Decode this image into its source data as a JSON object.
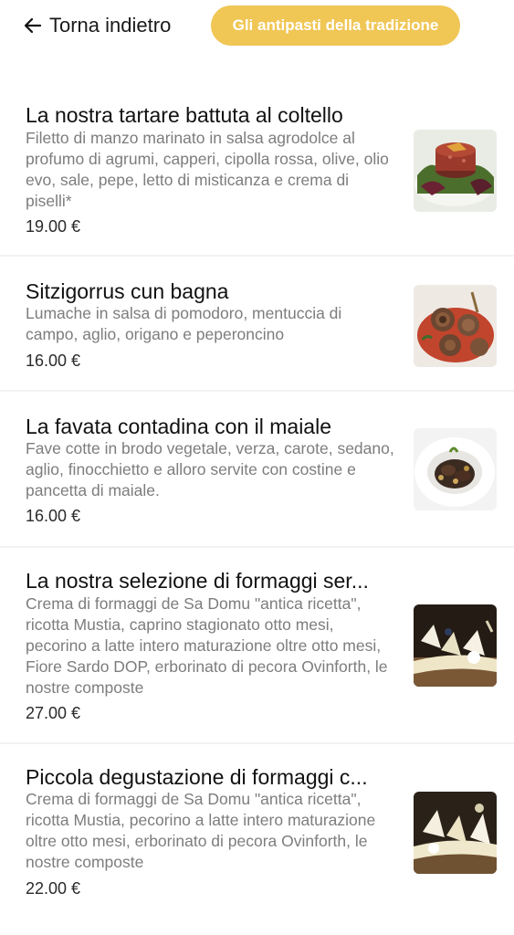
{
  "header": {
    "back_label": "Torna indietro",
    "category": "Gli antipasti della tradizione"
  },
  "items": [
    {
      "title": "La nostra tartare battuta al coltello",
      "description": "Filetto di manzo marinato in salsa agrodolce al profumo di agrumi, capperi, cipolla rossa, olive, olio evo, sale, pepe, letto di misticanza e crema di piselli*",
      "price": "19.00 €",
      "image": "tartare-photo"
    },
    {
      "title": "Sitzigorrus cun bagna",
      "description": "Lumache in salsa di pomodoro, mentuccia di campo, aglio, origano e peperoncino",
      "price": "16.00 €",
      "image": "snails-photo"
    },
    {
      "title": "La favata contadina con il maiale",
      "description": "Fave cotte in brodo vegetale, verza, carote, sedano, aglio, finocchietto e alloro servite con costine e pancetta di maiale.",
      "price": "16.00 €",
      "image": "favata-photo"
    },
    {
      "title": "La nostra selezione di formaggi ser...",
      "description": "Crema di formaggi de Sa Domu \"antica ricetta\", ricotta Mustia, caprino stagionato otto mesi, pecorino a latte intero maturazione oltre otto mesi, Fiore Sardo DOP, erborinato di pecora Ovinforth, le nostre composte",
      "price": "27.00 €",
      "image": "cheese-selection-photo"
    },
    {
      "title": "Piccola degustazione di formaggi c...",
      "description": "Crema di formaggi de Sa Domu \"antica ricetta\", ricotta Mustia, pecorino a latte intero maturazione oltre otto mesi, erborinato di pecora Ovinforth, le nostre composte",
      "price": "22.00 €",
      "image": "cheese-tasting-photo"
    }
  ],
  "colors": {
    "accent": "#f0c655",
    "description": "#7d7d7d",
    "divider": "#f2f2f2"
  }
}
